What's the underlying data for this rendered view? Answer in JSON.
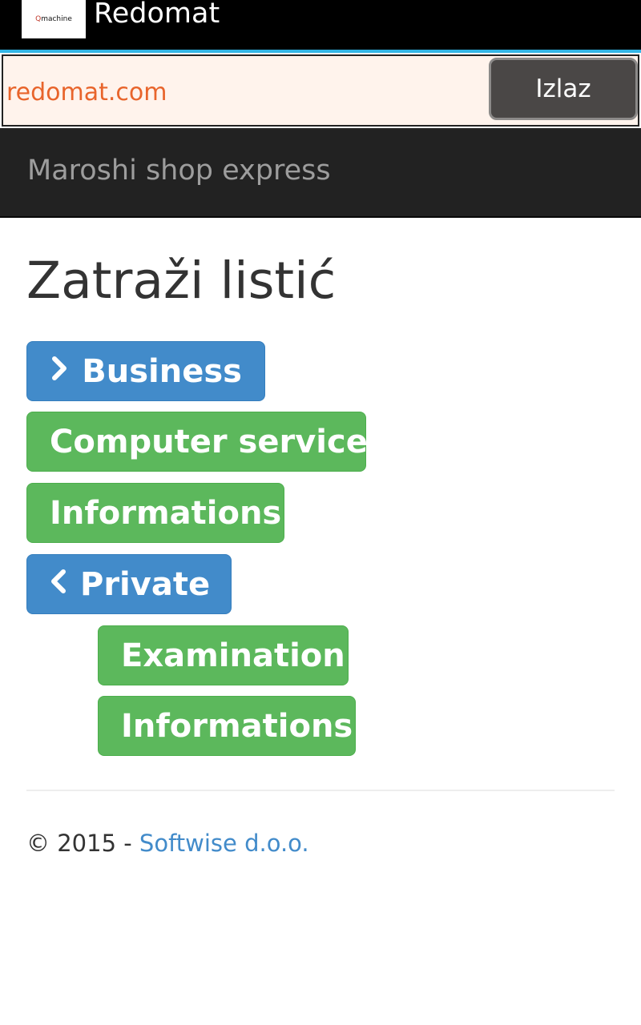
{
  "app_bar": {
    "logo_text_q": "Q",
    "logo_text_rest": "machine",
    "title": "Redomat"
  },
  "url_bar": {
    "url": "redomat.com",
    "exit_label": "Izlaz"
  },
  "navbar": {
    "brand": "Maroshi shop express"
  },
  "page": {
    "title": "Zatraži listić",
    "buttons": [
      {
        "label": "Business",
        "icon": "chevron-right-icon"
      },
      {
        "label": "Computer service"
      },
      {
        "label": "Informations"
      },
      {
        "label": "Private",
        "icon": "chevron-left-icon"
      },
      {
        "label": "Examination"
      },
      {
        "label": "Informations"
      }
    ]
  },
  "footer": {
    "copyright": "© 2015 - ",
    "company_link": "Softwise d.o.o."
  },
  "colors": {
    "primary_blue": "#428bca",
    "success_green": "#5cb85c",
    "navbar_bg": "#222222",
    "accent_rule": "#33b5e5",
    "url_text": "#e8642b"
  }
}
